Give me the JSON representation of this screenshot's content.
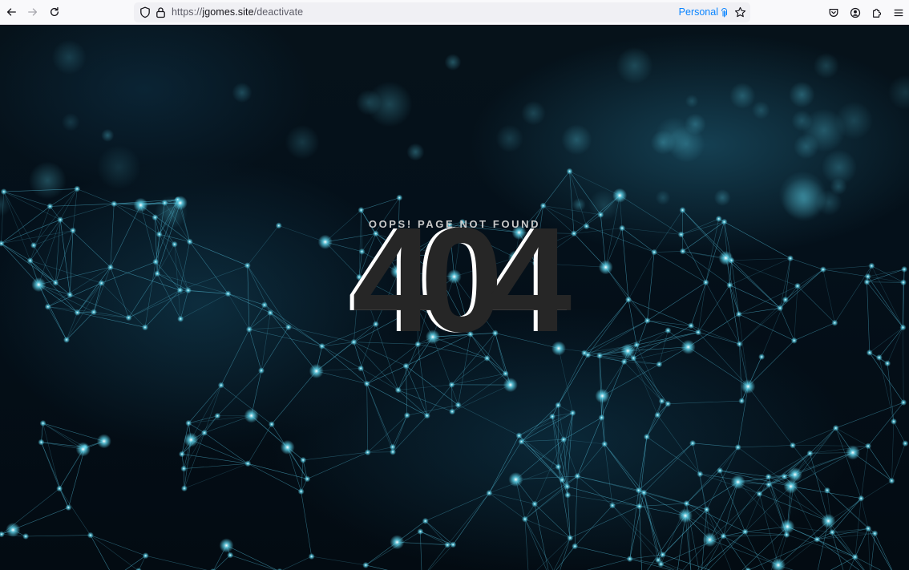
{
  "browser": {
    "url_prefix": "https://",
    "url_host": "jgomes.site",
    "url_path": "/deactivate",
    "container": "Personal",
    "icons": {
      "back": "back-arrow-icon",
      "forward": "forward-arrow-icon",
      "reload": "reload-icon",
      "tracking": "shield-icon",
      "lock": "lock-icon",
      "bookmark": "star-icon",
      "pocket": "pocket-icon",
      "account": "account-icon",
      "extensions": "extensions-icon",
      "menu": "hamburger-menu-icon"
    }
  },
  "page": {
    "subtitle": "OOPS! PAGE NOT FOUND",
    "code": "404"
  },
  "colors": {
    "accent": "#0a84ff",
    "code_fill": "#262626",
    "code_shadow": "#ffffff",
    "node_glow": "#5fd8f0"
  }
}
